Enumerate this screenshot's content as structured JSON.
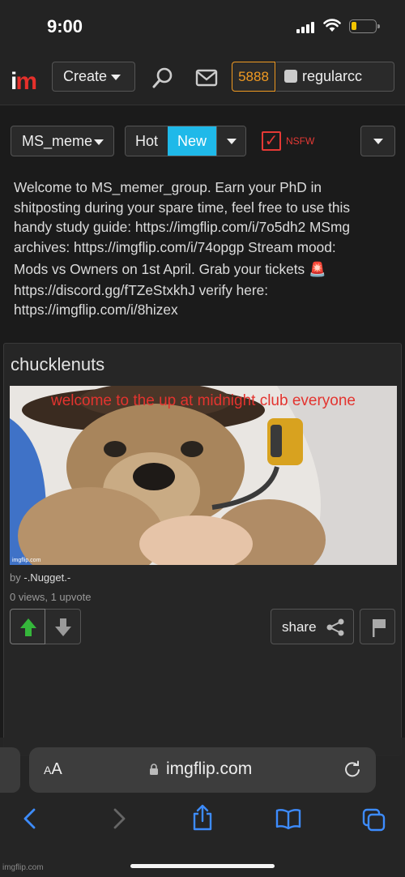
{
  "status_bar": {
    "time": "9:00"
  },
  "header": {
    "logo_i": "i",
    "logo_m": "m",
    "create_label": "Create",
    "points": "5888",
    "username": "regularcc"
  },
  "controls": {
    "group_select": "MS_meme",
    "sort_hot": "Hot",
    "sort_new": "New",
    "nsfw_check": "✓",
    "nsfw_label": "NSFW"
  },
  "description": {
    "line1": "Welcome to MS_memer_group. Earn your PhD in",
    "line2": "shitposting during your spare time, feel free to use this",
    "line3": "handy study guide: https://imgflip.com/i/7o5dh2 MSmg",
    "line4": "archives: https://imgflip.com/i/74opgp Stream mood:",
    "line5": "Mods vs Owners on 1st April. Grab your tickets 🚨",
    "line6": "https://discord.gg/fTZeStxkhJ verify here:",
    "line7": "https://imgflip.com/i/8hizex"
  },
  "post": {
    "title": "chucklenuts",
    "caption": "welcome to the up at midnight club everyone",
    "image_watermark": "imgflip.com",
    "by_prefix": "by",
    "author": "-.Nugget.-",
    "stats": "0 views, 1 upvote",
    "share_label": "share"
  },
  "browser": {
    "aa_small": "A",
    "aa_big": "A",
    "url": "imgflip.com",
    "bottom_watermark": "imgflip.com"
  },
  "colors": {
    "accent_blue": "#1fb9e9",
    "points_orange": "#f09a22",
    "nsfw_red": "#e53935",
    "upvote_green": "#35b73b"
  }
}
